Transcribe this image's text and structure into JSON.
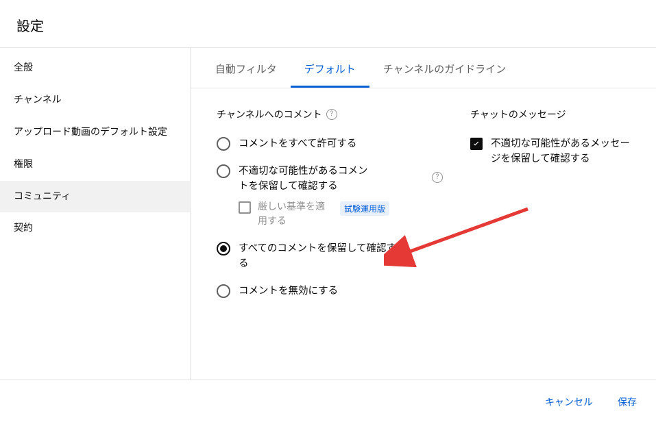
{
  "header": {
    "title": "設定"
  },
  "sidebar": {
    "items": [
      {
        "label": "全般"
      },
      {
        "label": "チャンネル"
      },
      {
        "label": "アップロード動画のデフォルト設定"
      },
      {
        "label": "権限"
      },
      {
        "label": "コミュニティ"
      },
      {
        "label": "契約"
      }
    ],
    "selectedIndex": 4
  },
  "tabs": {
    "items": [
      {
        "label": "自動フィルタ"
      },
      {
        "label": "デフォルト"
      },
      {
        "label": "チャンネルのガイドライン"
      }
    ],
    "activeIndex": 1
  },
  "comments": {
    "title": "チャンネルへのコメント",
    "options": [
      {
        "label": "コメントをすべて許可する"
      },
      {
        "label": "不適切な可能性があるコメントを保留して確認する"
      },
      {
        "label": "すべてのコメントを保留して確認する"
      },
      {
        "label": "コメントを無効にする"
      }
    ],
    "selectedIndex": 2,
    "strict": {
      "label": "厳しい基準を適用する",
      "badge": "試験運用版"
    }
  },
  "chat": {
    "title": "チャットのメッセージ",
    "checkbox": {
      "label": "不適切な可能性があるメッセージを保留して確認する",
      "checked": true
    }
  },
  "footer": {
    "cancel": "キャンセル",
    "save": "保存"
  },
  "colors": {
    "primary": "#065fd4",
    "arrow": "#e53935"
  }
}
